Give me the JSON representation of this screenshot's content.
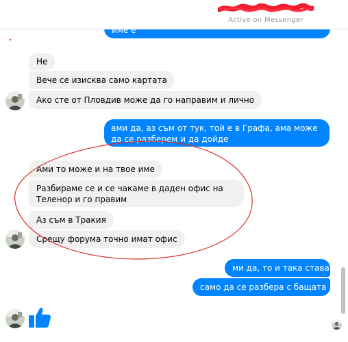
{
  "header": {
    "contact_name": "",
    "status": "Active on Messenger"
  },
  "messages": {
    "top_partial": "име е",
    "m1": "Не",
    "m2": "Вече се изисква само картата",
    "m3": "Ако сте от Пловдив може да го направим и лично",
    "out1": "ами да, аз съм от тук, той е в Графа, ама може да се разберем и да дойде",
    "m4": "Ами то може и на твое име",
    "m5": "Разбираме се и се чакаме в даден офис на Теленор и го правим",
    "m6": "Аз съм в Тракия",
    "m7": "Срещу форума точно имат офис",
    "out2": "ми да, то и така става",
    "out3": "само да се разбера с бащата"
  },
  "like_icon": "thumbs-up-icon",
  "colors": {
    "outgoing_bubble": "#0084ff",
    "incoming_bubble": "#f1f0f0",
    "annotation": "#d93025",
    "status_text": "#90949c"
  }
}
